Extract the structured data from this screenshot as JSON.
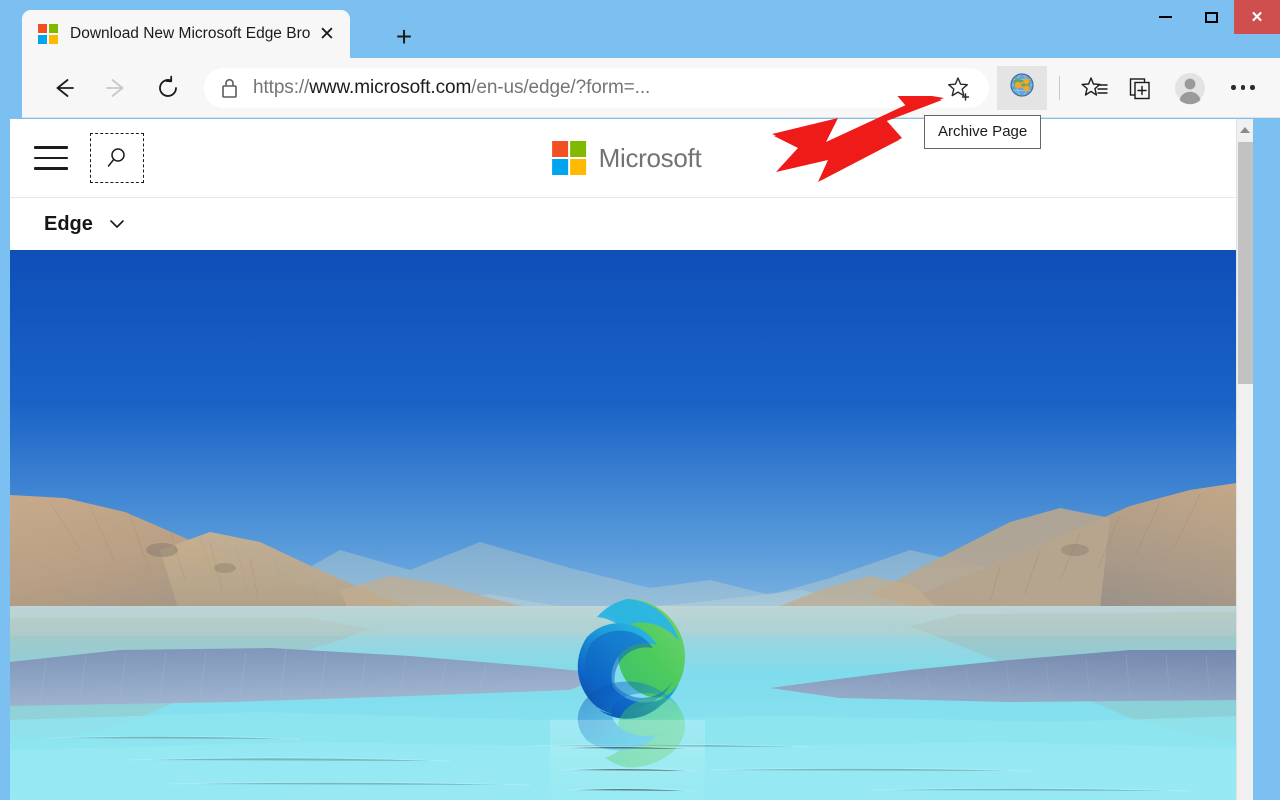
{
  "window": {
    "controls": {
      "minimize": "Minimize",
      "maximize": "Restore",
      "close": "Close"
    }
  },
  "tabstrip": {
    "tabs": [
      {
        "title": "Download New Microsoft Edge Browser | Microsoft",
        "favicon": "microsoft-logo-icon",
        "close_label": "✕",
        "active": true
      }
    ],
    "new_tab_label": "+",
    "new_tab_name": "new-tab-button"
  },
  "toolbar": {
    "back_label": "Back",
    "forward_label": "Forward",
    "refresh_label": "Refresh",
    "url": {
      "scheme": "https://",
      "host": "www.microsoft.com",
      "path": "/en-us/edge/?form=...",
      "full": "https://www.microsoft.com/en-us/edge/?form=...",
      "secure_icon": "lock-icon"
    },
    "favorite_label": "Add this page to favorites",
    "extension": {
      "name": "Archive Page",
      "icon": "archive-globe-share-icon",
      "active": true
    },
    "favorites_label": "Favorites",
    "collections_label": "Collections",
    "profile_label": "Profile",
    "settings_label": "Settings and more"
  },
  "tooltip": {
    "text": "Archive Page",
    "visible": true
  },
  "page": {
    "header": {
      "menu_label": "All Microsoft",
      "search_label": "Search",
      "brand_text": "Microsoft",
      "brand_icon": "microsoft-logo-icon"
    },
    "subnav": {
      "label": "Edge",
      "chevron": "chevron-down-icon"
    },
    "hero": {
      "alt": "Microsoft Edge logo over a turquoise lake landscape with hills",
      "logo_name": "edge-logo",
      "colors": {
        "sky_top": "#0f56bf",
        "sky_bottom": "#cfe6f2",
        "water": "#86e4ef",
        "hill": "#c3a887",
        "reeds": "#7d93b8",
        "edge_blue": "#0f62c4",
        "edge_cyan": "#2ab6e4",
        "edge_green": "#4cc85f"
      }
    }
  },
  "scrollbar": {
    "up_arrow": "scroll-up-arrow",
    "position": "top"
  },
  "annotation": {
    "arrow_color": "#ee1b18",
    "points_to": "Archive Page extension button"
  }
}
